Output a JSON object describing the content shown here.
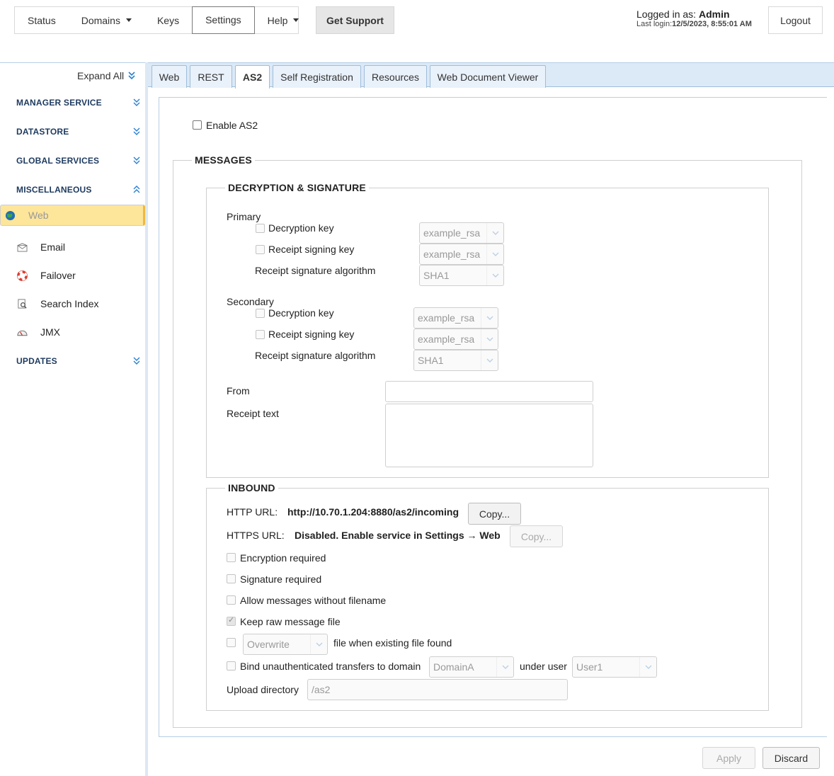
{
  "nav": {
    "status": "Status",
    "domains": "Domains",
    "keys": "Keys",
    "settings": "Settings",
    "help": "Help",
    "get_support": "Get Support"
  },
  "login": {
    "label": "Logged in as:",
    "user": "Admin",
    "last_label": "Last login:",
    "last_value": "12/5/2023, 8:55:01 AM",
    "logout": "Logout"
  },
  "sidebar": {
    "expand_all": "Expand All",
    "sections": [
      "MANAGER SERVICE",
      "DATASTORE",
      "GLOBAL SERVICES",
      "MISCELLANEOUS",
      "UPDATES"
    ],
    "items": [
      "Web",
      "Email",
      "Failover",
      "Search Index",
      "JMX"
    ],
    "selected": "Web"
  },
  "tabs": [
    "Web",
    "REST",
    "AS2",
    "Self Registration",
    "Resources",
    "Web Document Viewer"
  ],
  "active_tab": "AS2",
  "as2": {
    "enable_label": "Enable AS2",
    "messages_legend": "MESSAGES",
    "decsig_legend": "DECRYPTION & SIGNATURE",
    "primary": {
      "title": "Primary",
      "decryption_label": "Decryption key",
      "decryption_value": "example_rsa",
      "signing_label": "Receipt signing key",
      "signing_value": "example_rsa",
      "algo_label": "Receipt signature algorithm",
      "algo_value": "SHA1"
    },
    "secondary": {
      "title": "Secondary",
      "decryption_label": "Decryption key",
      "decryption_value": "example_rsa",
      "signing_label": "Receipt signing key",
      "signing_value": "example_rsa",
      "algo_label": "Receipt signature algorithm",
      "algo_value": "SHA1"
    },
    "from_label": "From",
    "from_value": "",
    "receipt_text_label": "Receipt text",
    "receipt_text_value": "",
    "inbound_legend": "INBOUND",
    "http_label": "HTTP URL:",
    "http_value": "http://10.70.1.204:8880/as2/incoming",
    "https_label": "HTTPS URL:",
    "https_value": "Disabled. Enable service in Settings → Web",
    "copy": "Copy...",
    "encryption_required": "Encryption required",
    "signature_required": "Signature required",
    "allow_no_filename": "Allow messages without filename",
    "keep_raw": "Keep raw message file",
    "keep_raw_checked": true,
    "overwrite_value": "Overwrite",
    "existing_file_label": "file when existing file found",
    "bind_label": "Bind unauthenticated transfers to domain",
    "domain_value": "DomainA",
    "under_user_label": "under user",
    "user_value": "User1",
    "upload_label": "Upload directory",
    "upload_value": "/as2"
  },
  "footer": {
    "apply": "Apply",
    "discard": "Discard"
  }
}
